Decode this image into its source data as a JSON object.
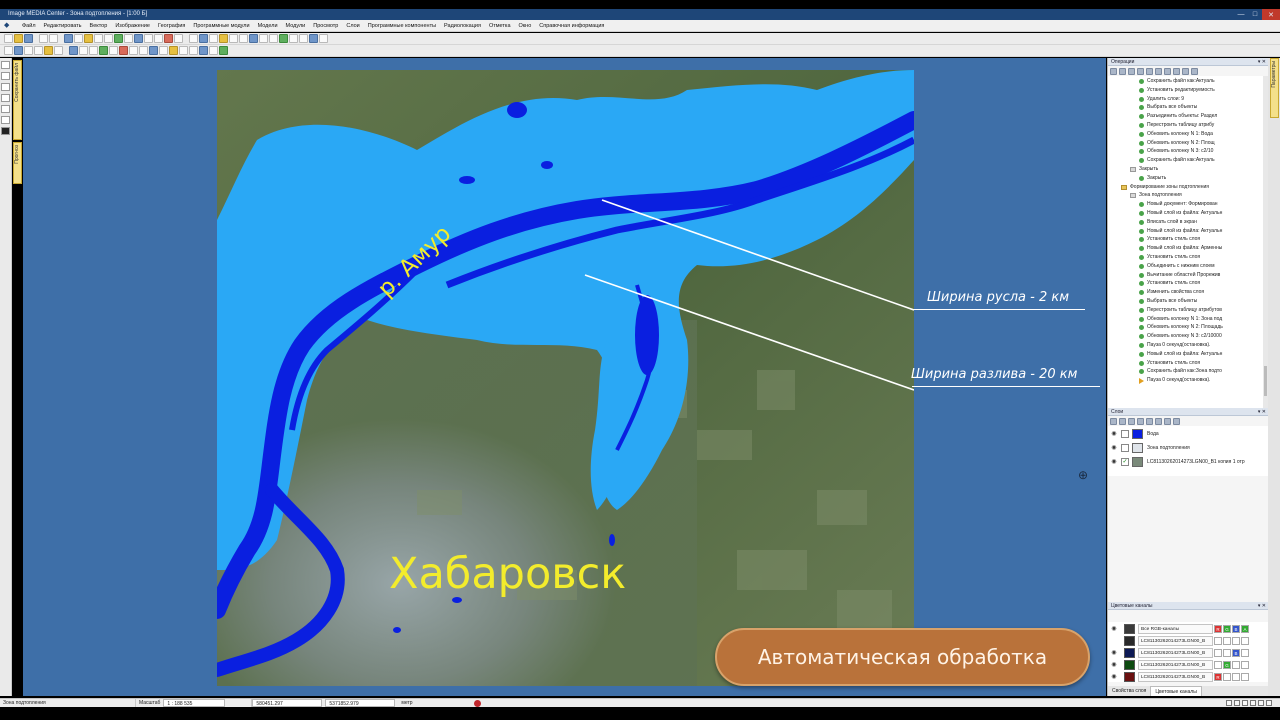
{
  "window": {
    "title": "Image MEDIA Center - Зона подтопления - [1:00 Б]",
    "buttons": {
      "minimize": "—",
      "maximize": "□",
      "close": "✕"
    }
  },
  "menu": {
    "items": [
      "Файл",
      "Редактировать",
      "Вектор",
      "Изображение",
      "География",
      "Программные модули",
      "Модели",
      "Модули",
      "Просмотр",
      "Слои",
      "Программные компоненты",
      "Радиолокация",
      "Отметка",
      "Окно",
      "Справочная информация"
    ]
  },
  "left_sidetabs": {
    "tab1": "Сохранить файл",
    "tab2": "Прогноз"
  },
  "right_sidetab": "Параметры",
  "map": {
    "river_label": "р. Амур",
    "city_label": "Хабаровск",
    "annotation_channel": "Ширина русла - 2 км",
    "annotation_flood": "Ширина разлива - 20 км",
    "badge": "Автоматическая обработка",
    "colors": {
      "flood": "#2aa8f5",
      "water": "#0a1fe0",
      "terrain": "#58704a",
      "city": "#8c9aa6",
      "label_yellow": "#f3ec2c"
    }
  },
  "operations_panel": {
    "title": "Операции",
    "pin": "▾ ✕",
    "items": [
      {
        "text": "Сохранить файл как:Актуаль",
        "kind": "op",
        "indent": 3
      },
      {
        "text": "Установить редактируемость",
        "kind": "op",
        "indent": 3
      },
      {
        "text": "Удалить слои: 9",
        "kind": "op",
        "indent": 3
      },
      {
        "text": "Выбрать все объекты",
        "kind": "op",
        "indent": 3
      },
      {
        "text": "Разъединить объекты: Раздел",
        "kind": "op",
        "indent": 3
      },
      {
        "text": "Перестроить таблицу атрибу",
        "kind": "op",
        "indent": 3
      },
      {
        "text": "Обновить колонку N 1: Вода",
        "kind": "op",
        "indent": 3
      },
      {
        "text": "Обновить колонку N 2: Площ",
        "kind": "op",
        "indent": 3
      },
      {
        "text": "Обновить колонку N 3: с2/10",
        "kind": "op",
        "indent": 3
      },
      {
        "text": "Сохранить файл как:Актуаль",
        "kind": "op",
        "indent": 3
      },
      {
        "text": "Закрыть",
        "kind": "folder-gray",
        "indent": 2
      },
      {
        "text": "Закрыть",
        "kind": "op",
        "indent": 3
      },
      {
        "text": "Формирование зоны подтопления",
        "kind": "folder",
        "indent": 1
      },
      {
        "text": "Зона подтопления",
        "kind": "folder-gray",
        "indent": 2
      },
      {
        "text": "Новый документ: Формирован",
        "kind": "op",
        "indent": 3
      },
      {
        "text": "Новый слой из файла: Актуальн",
        "kind": "op",
        "indent": 3
      },
      {
        "text": "Вписать слой в экран",
        "kind": "op",
        "indent": 3
      },
      {
        "text": "Новый слой из файла: Актуальн",
        "kind": "op",
        "indent": 3
      },
      {
        "text": "Установить стиль слоя",
        "kind": "op",
        "indent": 3
      },
      {
        "text": "Новый слой из файла: Арменны",
        "kind": "op",
        "indent": 3
      },
      {
        "text": "Установить стиль слоя",
        "kind": "op",
        "indent": 3
      },
      {
        "text": "Объединить с нижним слоем",
        "kind": "op",
        "indent": 3
      },
      {
        "text": "Вычитание областей Прорежив",
        "kind": "op",
        "indent": 3
      },
      {
        "text": "Установить стиль слоя",
        "kind": "op",
        "indent": 3
      },
      {
        "text": "Изменить свойства слоя",
        "kind": "op",
        "indent": 3
      },
      {
        "text": "Выбрать все объекты",
        "kind": "op",
        "indent": 3
      },
      {
        "text": "Перестроить таблицу атрибутов",
        "kind": "op",
        "indent": 3
      },
      {
        "text": "Обновить колонку N 1: Зона под",
        "kind": "op",
        "indent": 3
      },
      {
        "text": "Обновить колонку N 2: Площадь",
        "kind": "op",
        "indent": 3
      },
      {
        "text": "Обновить колонку N 3: с2/10000",
        "kind": "op",
        "indent": 3
      },
      {
        "text": "Пауза 0 секунд(остановка).",
        "kind": "op",
        "indent": 3
      },
      {
        "text": "Новый слой из файла: Актуальн",
        "kind": "op",
        "indent": 3
      },
      {
        "text": "Установить стиль слоя",
        "kind": "op",
        "indent": 3
      },
      {
        "text": "Сохранить файл как:Зона подто",
        "kind": "op",
        "indent": 3
      },
      {
        "text": "Пауза 0 секунд(остановка).",
        "kind": "arrow",
        "indent": 3
      }
    ]
  },
  "layers_panel": {
    "title": "Слои",
    "pin": "▾ ✕",
    "rows": [
      {
        "name": "Вода",
        "swatch": "#0a1fe0",
        "checked": false
      },
      {
        "name": "Зона подтопления",
        "swatch": "#dfe4ea",
        "checked": false
      },
      {
        "name": "LC81130262014273LGN00_B1 копия 1 отр",
        "swatch": "#7a8a7a",
        "checked": true
      }
    ]
  },
  "channels_panel": {
    "title": "Цветовые каналы",
    "pin": "▾ ✕",
    "rows": [
      {
        "name": "Все RGB-каналы",
        "swatch": "#3a3a3a",
        "cells": [
          "R",
          "G",
          "B",
          "A"
        ]
      },
      {
        "name": "LC81130262014273LGN00_B",
        "swatch": "#2a2a2a",
        "cells": [
          "",
          "",
          "",
          ""
        ]
      },
      {
        "name": "LC81130262014273LGN00_B",
        "swatch": "#0d1a55",
        "cells": [
          "",
          "",
          "B",
          ""
        ]
      },
      {
        "name": "LC81130262014273LGN00_B",
        "swatch": "#0d4a10",
        "cells": [
          "",
          "G",
          "",
          ""
        ]
      },
      {
        "name": "LC81130262014273LGN00_B",
        "swatch": "#6a1010",
        "cells": [
          "R",
          "",
          "",
          ""
        ]
      }
    ],
    "tabs": [
      "Свойства слоя",
      "Цветовые каналы"
    ]
  },
  "status": {
    "layer": "Зона подтопления",
    "scale_label": "Масштаб",
    "scale_value": "1 : 188 535",
    "x": "580451.297",
    "y": "5371852.979",
    "units": "метр"
  }
}
